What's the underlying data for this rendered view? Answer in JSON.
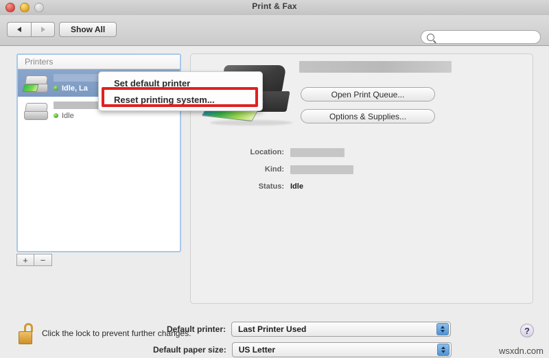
{
  "window": {
    "title": "Print & Fax",
    "traffic_lights": [
      "close-button",
      "minimize-button",
      "zoom-button"
    ]
  },
  "toolbar": {
    "back_label": "back-arrow",
    "forward_label": "forward-arrow",
    "show_all_label": "Show All",
    "search": {
      "value": "",
      "placeholder": "",
      "icon": "search-icon"
    }
  },
  "printers_list": {
    "header": "Printers",
    "items": [
      {
        "name": "",
        "name_redacted": true,
        "status": "Idle, La",
        "selected": true,
        "icon": "printer-icon"
      },
      {
        "name": "",
        "name_redacted": true,
        "status": "Idle",
        "selected": false,
        "icon": "printer-icon"
      }
    ],
    "add_label": "+",
    "remove_label": "−"
  },
  "context_menu": {
    "items": [
      {
        "label": "Set default printer",
        "highlighted": false
      },
      {
        "label": "Reset printing system...",
        "highlighted": true
      }
    ],
    "highlight_color": "#e02020"
  },
  "detail": {
    "printer_name": "",
    "printer_name_redacted": true,
    "printer_illustration": "printer-illustration",
    "buttons": [
      {
        "label": "Open Print Queue..."
      },
      {
        "label": "Options & Supplies..."
      }
    ],
    "info": [
      {
        "label": "Location:",
        "value": "",
        "redacted": true
      },
      {
        "label": "Kind:",
        "value": "",
        "redacted": true
      },
      {
        "label": "Status:",
        "value": "Idle",
        "redacted": false
      }
    ]
  },
  "form": {
    "default_printer": {
      "label": "Default printer:",
      "value": "Last Printer Used"
    },
    "default_paper_size": {
      "label": "Default paper size:",
      "value": "US Letter"
    }
  },
  "footer": {
    "lock_icon": "unlocked-padlock-icon",
    "lock_text": "Click the lock to prevent further changes.",
    "help_label": "?",
    "watermark": "wsxdn.com"
  }
}
